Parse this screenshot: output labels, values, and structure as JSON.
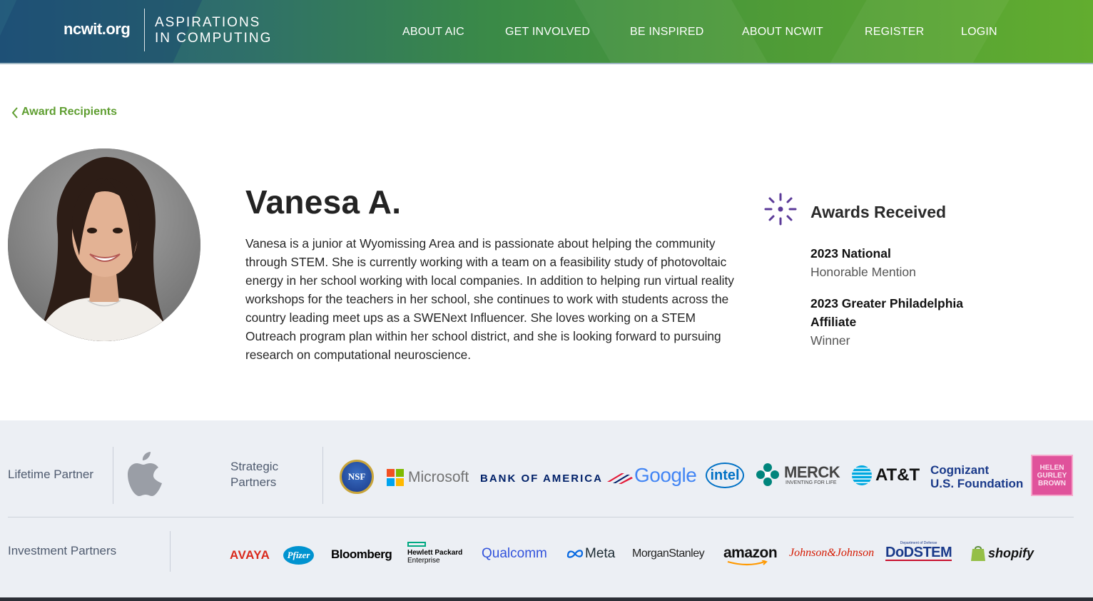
{
  "header": {
    "logo_ncwit": "ncwit.org",
    "logo_aic_line1": "ASPIRATIONS",
    "logo_aic_line2": "IN COMPUTING",
    "nav": [
      {
        "label": "ABOUT AIC"
      },
      {
        "label": "GET INVOLVED"
      },
      {
        "label": "BE INSPIRED"
      },
      {
        "label": "ABOUT NCWIT"
      },
      {
        "label": "REGISTER"
      },
      {
        "label": "LOGIN"
      }
    ]
  },
  "back_link": {
    "label": "Award Recipients",
    "icon": "chevron-left-icon"
  },
  "profile": {
    "name": "Vanesa A.",
    "bio": "Vanesa is a junior at Wyomissing Area and is passionate about helping the community through STEM. She is currently working with a team on a feasibility study of photovoltaic energy in her school working with local companies. In addition to helping run virtual reality workshops for the teachers in her school, she continues to work with students across the country leading meet ups as a SWENext Influencer. She loves working on a STEM Outreach program plan within her school district, and she is looking forward to pursuing research on computational neuroscience."
  },
  "awards": {
    "title": "Awards Received",
    "icon": "sparkle-burst-icon",
    "icon_color": "#5b3a98",
    "items": [
      {
        "title": "2023 National",
        "subtitle": "Honorable Mention"
      },
      {
        "title": "2023 Greater Philadelphia Affiliate",
        "subtitle": "Winner"
      }
    ]
  },
  "partners": {
    "lifetime_label": "Lifetime Partner",
    "lifetime_logo": "apple-logo-icon",
    "strategic_label": "Strategic Partners",
    "strategic_logos": {
      "nsf": "NSF",
      "microsoft": "Microsoft",
      "boa": "BANK OF AMERICA",
      "google": "Google",
      "intel": "intel",
      "merck": "MERCK",
      "merck_sub": "INVENTING FOR LIFE",
      "att": "AT&T",
      "cognizant_1": "Cognizant",
      "cognizant_2": "U.S. Foundation",
      "hgb_1": "HELEN",
      "hgb_2": "GURLEY",
      "hgb_3": "BROWN"
    },
    "investment_label": "Investment Partners",
    "investment_logos": {
      "avaya": "AVAYA",
      "pfizer": "Pfizer",
      "bloomberg": "Bloomberg",
      "hpe_1": "Hewlett Packard",
      "hpe_2": "Enterprise",
      "qualcomm": "Qualcomm",
      "meta": "Meta",
      "morgan": "MorganStanley",
      "amazon": "amazon",
      "jnj": "Johnson&Johnson",
      "dod_small": "Department of Defense",
      "dod": "DoDSTEM",
      "shopify": "shopify"
    }
  },
  "colors": {
    "accent_green": "#5f9e31",
    "award_purple": "#5b3a98",
    "partners_bg": "#eceff4"
  }
}
